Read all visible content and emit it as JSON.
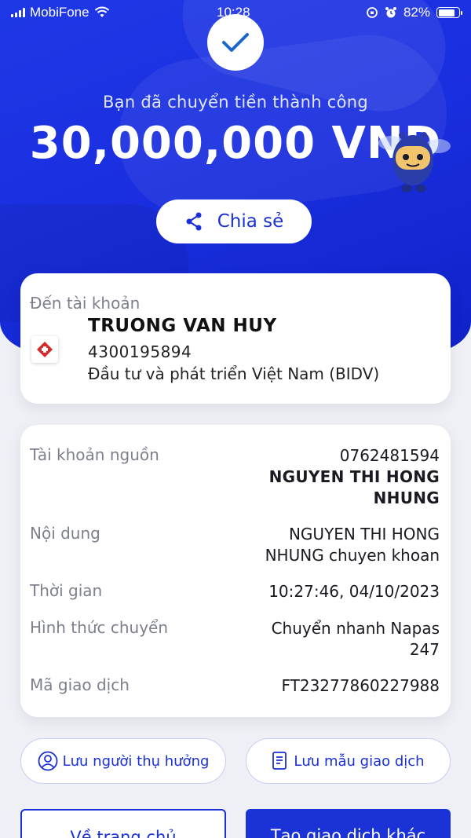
{
  "status_bar": {
    "carrier": "MobiFone",
    "time": "10:28",
    "battery": "82%"
  },
  "hero": {
    "success_message": "Bạn đã chuyển tiền thành công",
    "amount": "30,000,000 VND",
    "share_label": "Chia sẻ"
  },
  "destination": {
    "label": "Đến tài khoản",
    "name": "TRUONG VAN HUY",
    "account_number": "4300195894",
    "bank": "Đầu tư và phát triển Việt Nam (BIDV)"
  },
  "details": {
    "source_label": "Tài khoản nguồn",
    "source_account": "0762481594",
    "source_name": "NGUYEN THI HONG NHUNG",
    "content_label": "Nội dung",
    "content_value": "NGUYEN THI HONG NHUNG chuyen khoan",
    "time_label": "Thời gian",
    "time_value": "10:27:46, 04/10/2023",
    "method_label": "Hình thức chuyển",
    "method_value": "Chuyển nhanh Napas 247",
    "txn_label": "Mã giao dịch",
    "txn_value": "FT23277860227988"
  },
  "actions": {
    "save_beneficiary": "Lưu người thụ hưởng",
    "save_template": "Lưu mẫu giao dịch",
    "home": "Về trang chủ",
    "new_transaction": "Tạo giao dịch khác"
  },
  "colors": {
    "brand_blue": "#1b33d6",
    "text_muted": "#7d808c"
  },
  "icons": [
    "wifi-icon",
    "signal-icon",
    "alarm-icon",
    "lock-rotation-icon",
    "battery-icon",
    "check-icon",
    "share-icon",
    "bidv-logo",
    "user-circle-icon",
    "document-icon"
  ]
}
